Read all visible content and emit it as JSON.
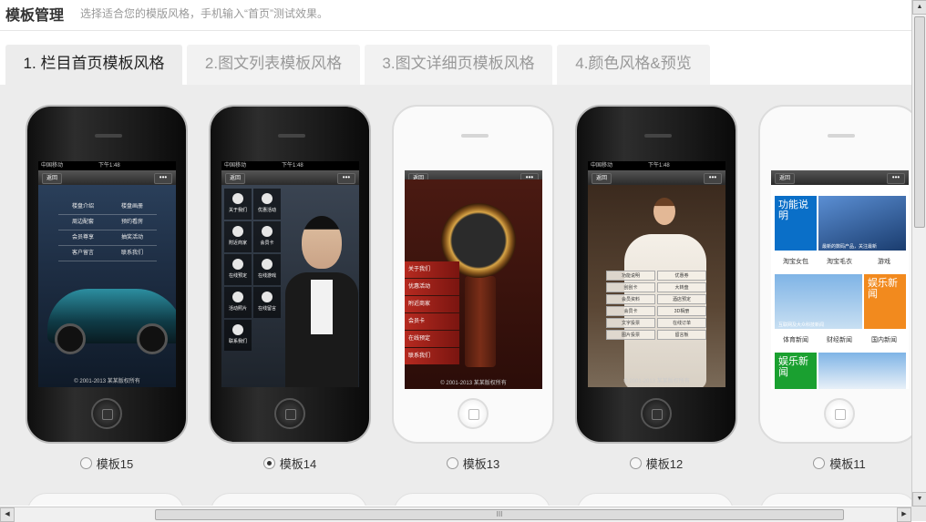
{
  "header": {
    "title": "模板管理",
    "hint": "选择适合您的模版风格，手机输入“首页”测试效果。"
  },
  "tabs": [
    {
      "label": "1. 栏目首页模板风格",
      "active": true
    },
    {
      "label": "2.图文列表模板风格",
      "active": false
    },
    {
      "label": "3.图文详细页模板风格",
      "active": false
    },
    {
      "label": "4.颜色风格&预览",
      "active": false
    }
  ],
  "phone_ui": {
    "carrier": "中国移动",
    "time": "下午1:48",
    "back": "返回",
    "more": "•••",
    "copyright": "© 2001-2013 某某版权所有"
  },
  "templates": [
    {
      "label": "模板15",
      "selected": false,
      "menu": [
        "楼盘介绍",
        "楼盘画册",
        "周边配套",
        "预约看房",
        "会员尊享",
        "抽奖活动",
        "客户留言",
        "联系我们"
      ]
    },
    {
      "label": "模板14",
      "selected": true,
      "menu": [
        "关于我们",
        "优惠活动",
        "附近商家",
        "会员卡",
        "在线预定",
        "在线游戏",
        "活动照片",
        "在线留言",
        "联系我们"
      ]
    },
    {
      "label": "模板13",
      "selected": false,
      "menu": [
        "关于我们",
        "优惠活动",
        "附近商家",
        "会员卡",
        "在线预定",
        "联系我们"
      ]
    },
    {
      "label": "模板12",
      "selected": false,
      "menu": [
        "功能说明",
        "优惠券",
        "刮刮卡",
        "大转盘",
        "会员资料",
        "酒店预定",
        "会员卡",
        "3D相册",
        "文字投票",
        "在线订单",
        "图片投票",
        "留言板"
      ]
    },
    {
      "label": "模板11",
      "selected": false,
      "tiles": {
        "feature": "功能说明",
        "news_caption": "最新的数码产品，关注最新",
        "ent": "娱乐新闻",
        "sci_caption": "互联网及大众科技新闻",
        "sport": "娱乐新闻"
      },
      "row1": [
        "淘宝女包",
        "淘宝毛衣",
        "游戏"
      ],
      "row2": [
        "体育新闻",
        "财经新闻",
        "国内新闻"
      ]
    }
  ],
  "scrollbar": {
    "up": "▲",
    "down": "▼",
    "left": "◀",
    "right": "▶",
    "grip": "III"
  }
}
